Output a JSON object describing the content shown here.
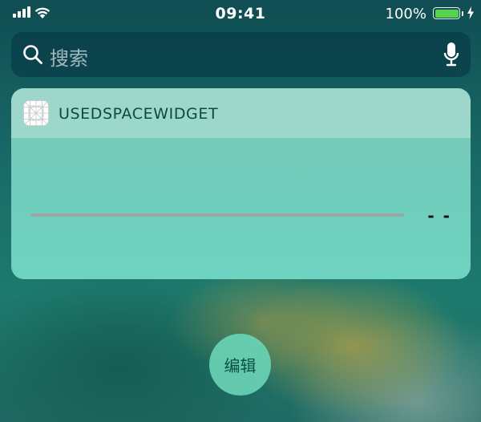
{
  "status_bar": {
    "time": "09:41",
    "battery_percent": "100%",
    "battery_level": 1.0,
    "signal_bars": 4,
    "icons": [
      "signal-icon",
      "wifi-icon",
      "battery-icon",
      "charging-bolt-icon"
    ]
  },
  "search": {
    "placeholder": "搜索",
    "icons": [
      "search-icon",
      "microphone-icon"
    ]
  },
  "widget": {
    "title": "USEDSPACEWIDGET",
    "app_icon": "app-placeholder-icon",
    "value": "- -",
    "progress": 0
  },
  "edit_button": {
    "label": "编辑"
  },
  "colors": {
    "widget_bg": "#6fcdbb",
    "widget_header_bg": "#a9dcd2",
    "edit_button_bg": "#69d2b4",
    "battery_fill": "#58d14c"
  }
}
